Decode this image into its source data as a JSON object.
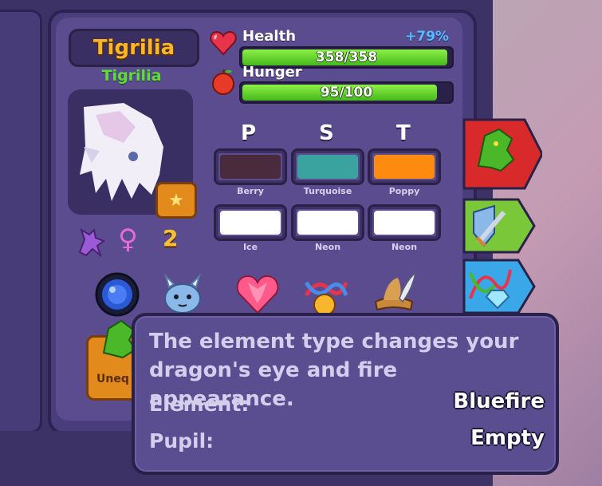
{
  "dragon": {
    "display_name": "Tigrilia",
    "species_name": "Tigrilia",
    "level": "2"
  },
  "stats": {
    "health_label": "Health",
    "health_bonus": "+79%",
    "health_value": "358/358",
    "health_fraction": 1.0,
    "hunger_label": "Hunger",
    "hunger_value": "95/100",
    "hunger_fraction": 0.95
  },
  "colors": {
    "headers": [
      "P",
      "S",
      "T"
    ],
    "swatches": [
      {
        "name": "Berry",
        "hex": "#4a2b3e"
      },
      {
        "name": "Turquoise",
        "hex": "#3aa3a0"
      },
      {
        "name": "Poppy",
        "hex": "#ff8a10"
      },
      {
        "name": "Ice",
        "hex": "#ffffff"
      },
      {
        "name": "Neon",
        "hex": "#ffffff"
      },
      {
        "name": "Neon",
        "hex": "#ffffff"
      }
    ]
  },
  "item_icons": [
    "element-orb-icon",
    "horned-pet-icon",
    "heart-gem-icon",
    "dna-medal-icon",
    "feathered-hat-icon"
  ],
  "side_tabs": [
    "dragon-tab-icon",
    "sword-shield-tab-icon",
    "dna-diamond-tab-icon"
  ],
  "unequip_label": "Uneq",
  "tooltip": {
    "description": "The element type changes your dragon's eye and fire appearance.",
    "element_label": "Element:",
    "element_value": "Bluefire",
    "pupil_label": "Pupil:",
    "pupil_value": "Empty"
  }
}
